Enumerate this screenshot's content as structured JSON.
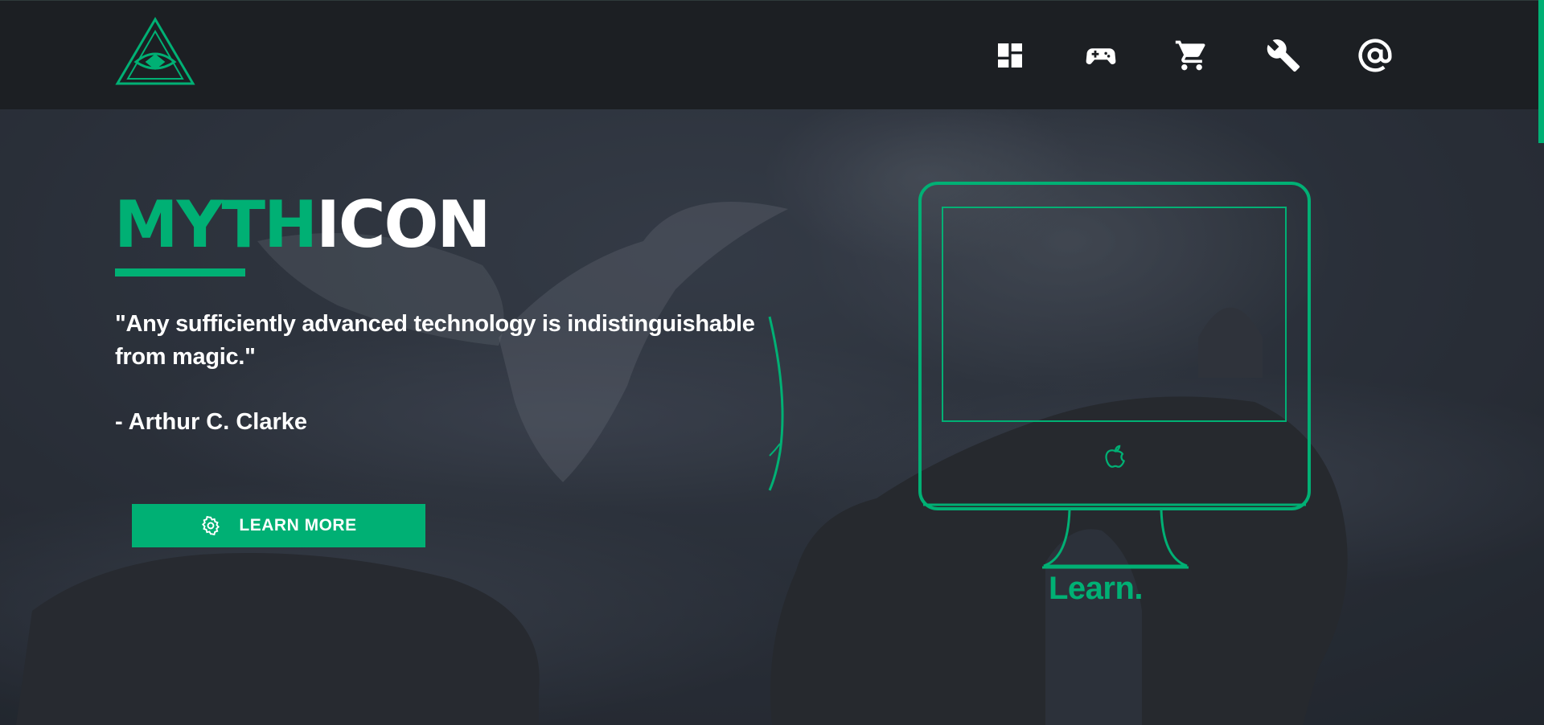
{
  "colors": {
    "accent": "#00b074",
    "header_bg": "#1c1f23",
    "text": "#ffffff",
    "scene_bg": "#2a2f38"
  },
  "header": {
    "logo_icon": "eye-pyramid-logo",
    "nav": [
      {
        "icon": "dashboard-icon"
      },
      {
        "icon": "gamepad-icon"
      },
      {
        "icon": "cart-icon"
      },
      {
        "icon": "wrench-icon"
      },
      {
        "icon": "at-sign-icon"
      }
    ]
  },
  "hero": {
    "brand_part1": "MYTH",
    "brand_part2": "ICON",
    "quote": "\"Any sufficiently advanced technology is indistinguishable from magic.\"",
    "author": "- Arthur C. Clarke",
    "button_label": "LEARN MORE",
    "button_icon": "gear-icon"
  },
  "illustration": {
    "icon": "apple-icon",
    "caption": "Learn."
  }
}
